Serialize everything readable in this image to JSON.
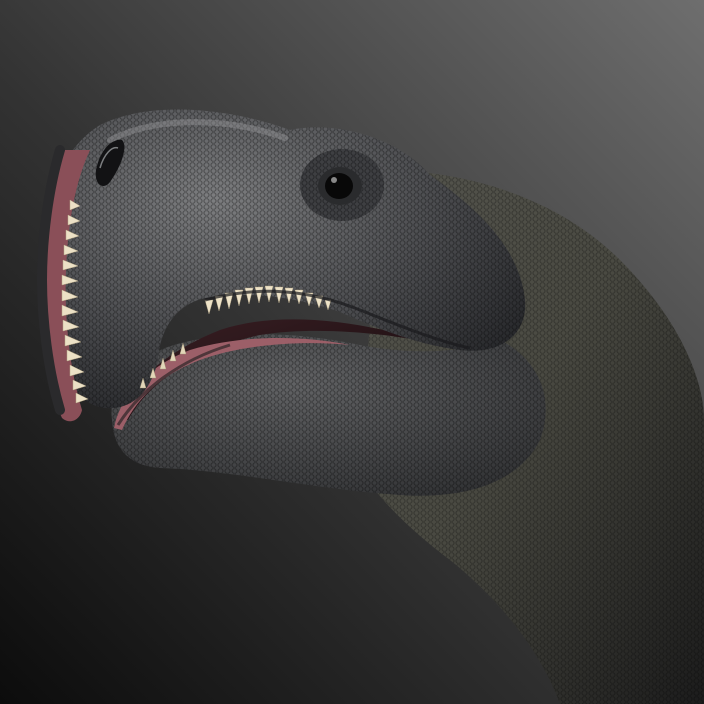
{
  "image": {
    "subject": "sauropod-dinosaur-head",
    "colors": {
      "background_top_right": "#6a6a6a",
      "background_bottom_left": "#0e0e0e",
      "skin_base": "#4a4a4c",
      "skin_highlight": "#7b7c7e",
      "skin_shadow": "#1f1f21",
      "neck_warm": "#5c5a48",
      "mouth_interior": "#6d3a40",
      "gum": "#a86a72",
      "teeth": "#e9dcc0",
      "eye": "#0a0a0a"
    }
  }
}
